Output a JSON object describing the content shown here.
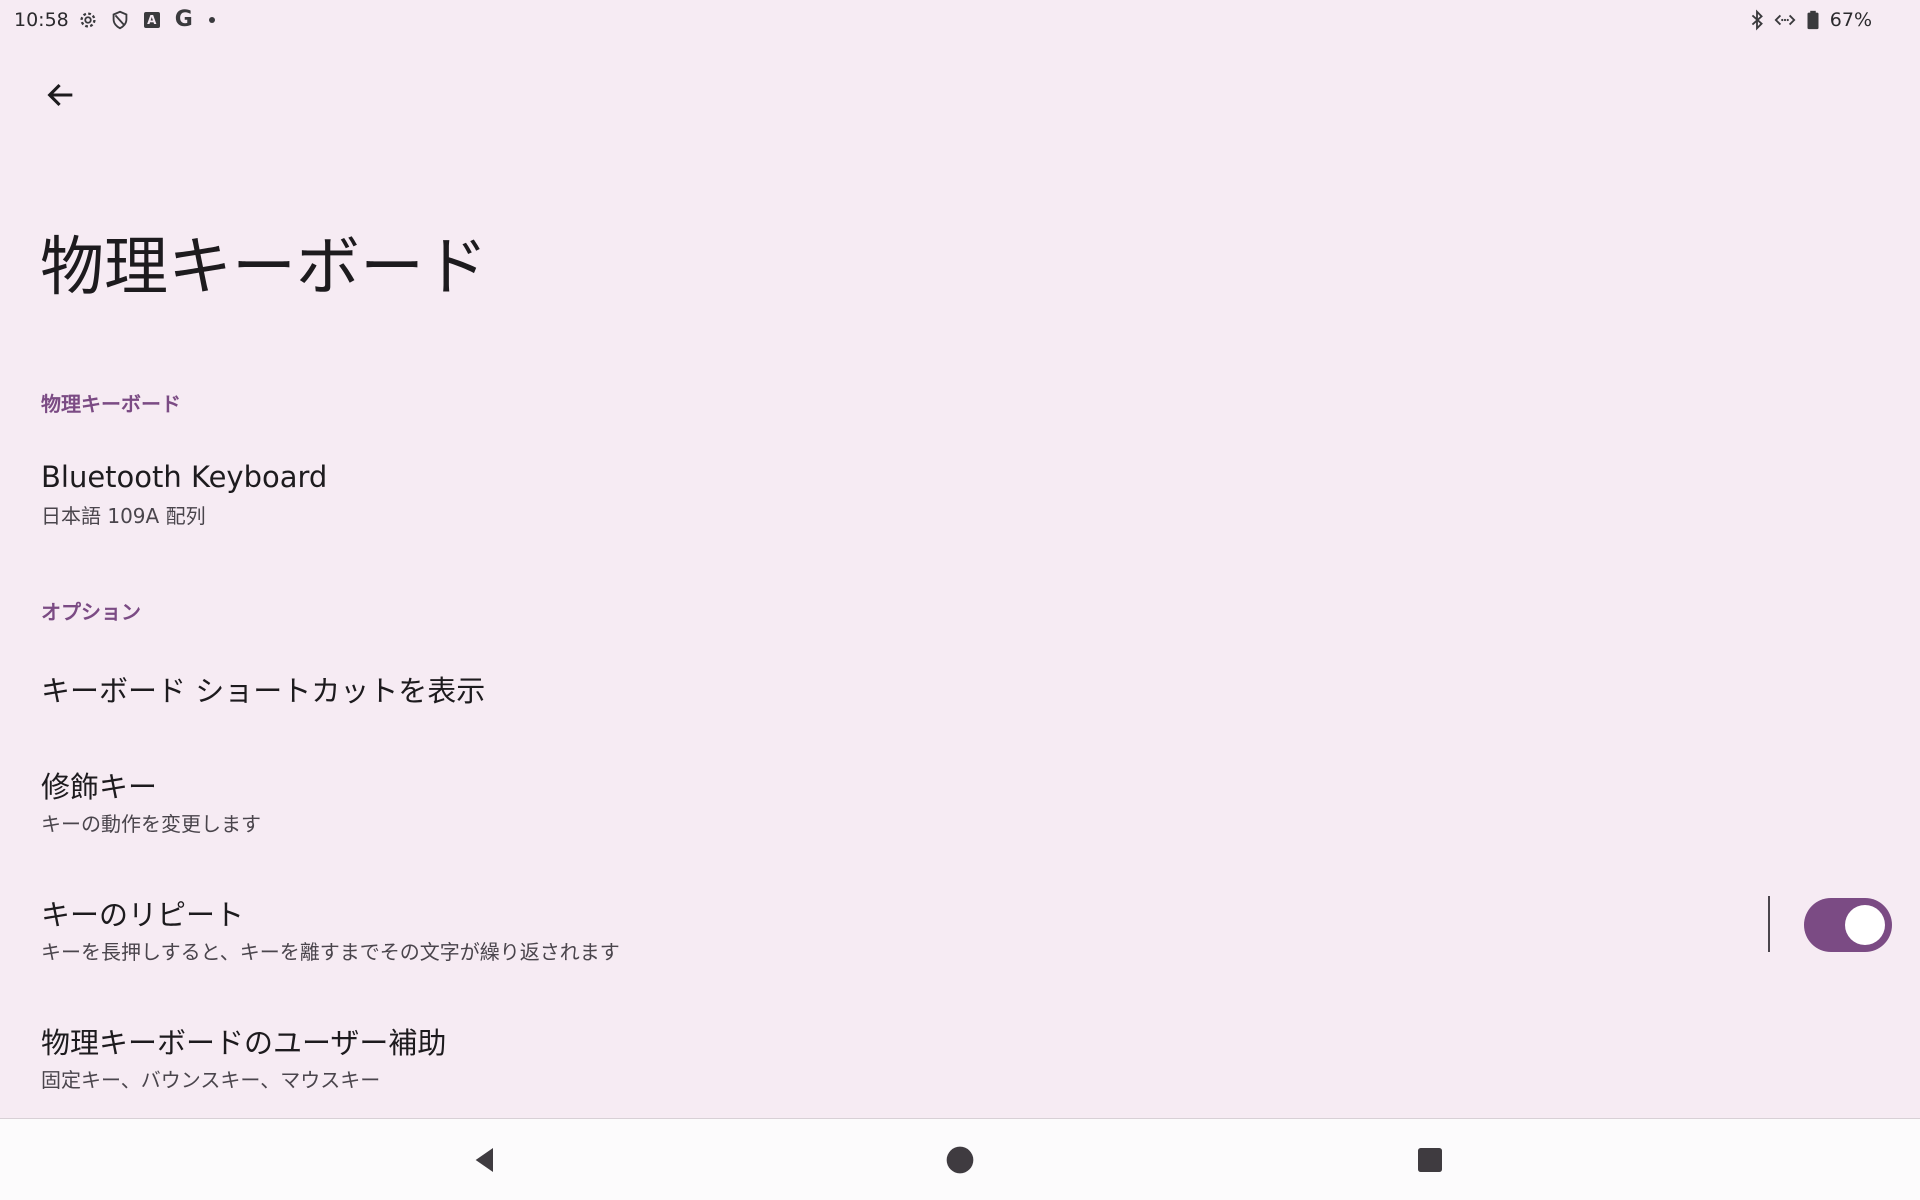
{
  "status_bar": {
    "time": "10:58",
    "left_icons": [
      "settings-gear-icon",
      "shield-icon",
      "a-letter-icon",
      "google-g-icon",
      "dot-icon"
    ],
    "a_letter": "A",
    "g_letter": "G",
    "right_icons": [
      "bluetooth-icon",
      "data-transfer-icon",
      "battery-icon"
    ],
    "battery": "67%"
  },
  "header": {
    "back_icon": "arrow-back-icon",
    "title": "物理キーボード"
  },
  "sections": {
    "physical_keyboard": {
      "header": "物理キーボード",
      "items": [
        {
          "title": "Bluetooth Keyboard",
          "summary": "日本語 109A 配列"
        }
      ]
    },
    "options": {
      "header": "オプション",
      "items": [
        {
          "title": "キーボード ショートカットを表示"
        },
        {
          "title": "修飾キー",
          "summary": "キーの動作を変更します"
        },
        {
          "title": "キーのリピート",
          "summary": "キーを長押しすると、キーを離すまでその文字が繰り返されます",
          "toggle": true
        },
        {
          "title": "物理キーボードのユーザー補助",
          "summary": "固定キー、バウンスキー、マウスキー"
        }
      ]
    }
  },
  "nav_bar": {
    "back_icon": "triangle-back-icon",
    "home_icon": "circle-home-icon",
    "recents_icon": "square-recents-icon"
  },
  "colors": {
    "background": "#f6ebf3",
    "accent": "#7b4b84",
    "text_primary": "#1d1b1e",
    "text_secondary": "#4a454c"
  }
}
